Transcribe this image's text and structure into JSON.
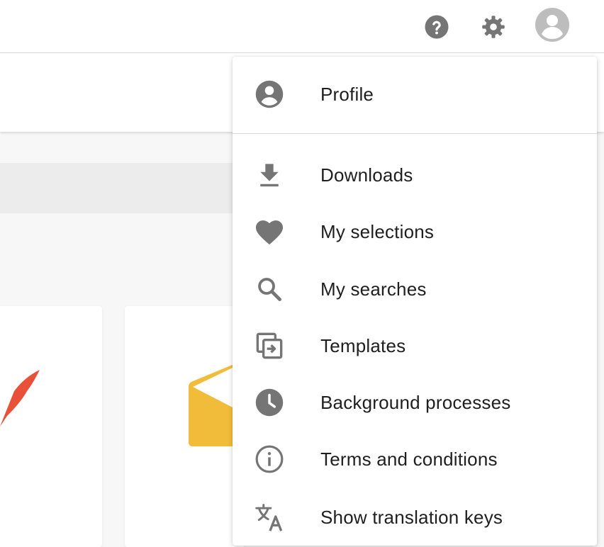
{
  "topbar": {
    "help_icon": "help-circle-icon",
    "settings_icon": "gear-icon",
    "avatar_icon": "user-avatar-icon"
  },
  "menu": {
    "items": [
      {
        "label": "Profile",
        "icon": "account-circle-icon"
      },
      {
        "label": "Downloads",
        "icon": "download-icon"
      },
      {
        "label": "My selections",
        "icon": "heart-icon"
      },
      {
        "label": "My searches",
        "icon": "search-icon"
      },
      {
        "label": "Templates",
        "icon": "template-icon"
      },
      {
        "label": "Background processes",
        "icon": "clock-icon"
      },
      {
        "label": "Terms and conditions",
        "icon": "info-icon"
      },
      {
        "label": "Show translation keys",
        "icon": "translate-icon"
      }
    ]
  },
  "colors": {
    "icon_gray": "#757575",
    "avatar_bg": "#bdbdbd",
    "card_red": "#e8503a",
    "card_yellow": "#f2bc3b"
  }
}
